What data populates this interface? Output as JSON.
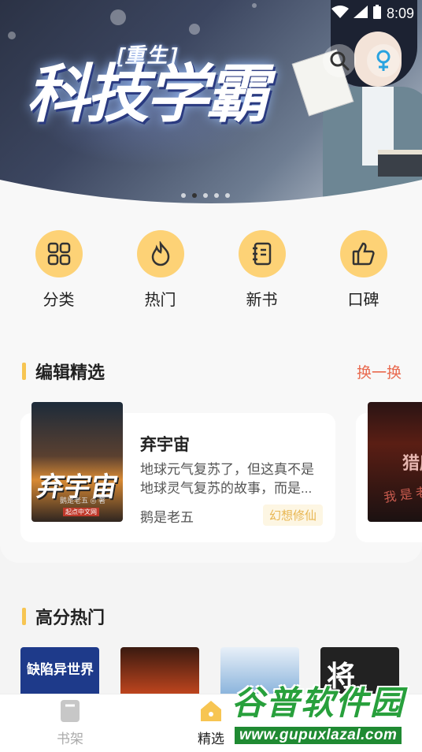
{
  "status_bar": {
    "time": "8:09"
  },
  "banner": {
    "subtitle": "[重生]",
    "title": "科技学霸",
    "page_count": 5,
    "active_page": 2
  },
  "quick_links": [
    {
      "label": "分类",
      "icon": "grid-icon"
    },
    {
      "label": "热门",
      "icon": "fire-icon"
    },
    {
      "label": "新书",
      "icon": "notebook-icon"
    },
    {
      "label": "口碑",
      "icon": "thumbs-up-icon"
    }
  ],
  "editor_picks": {
    "title": "编辑精选",
    "action": "换一换",
    "book": {
      "cover_title": "弃宇宙",
      "cover_author": "鹅是老五 ◎ 著",
      "cover_publisher": "起点中文网",
      "title": "弃宇宙",
      "description": "地球元气复苏了，但这真不是地球灵气复苏的故事，而是...",
      "author": "鹅是老五",
      "tag": "幻想修仙"
    },
    "next_book": {
      "cover_title": "猎魔",
      "cover_sub": "我 是 老"
    }
  },
  "hot": {
    "title": "高分热门",
    "covers": [
      {
        "text": "缺陷异世界",
        "color": "#1e3a8a"
      },
      {
        "text": "",
        "color": "#b0391c"
      },
      {
        "text": "",
        "color": "#9cc4e4"
      },
      {
        "text": "将",
        "color": "#222222"
      }
    ]
  },
  "bottom_nav": {
    "items": [
      {
        "label": "书架",
        "icon": "bookshelf-icon",
        "active": false
      },
      {
        "label": "精选",
        "icon": "home-icon",
        "active": true
      }
    ]
  },
  "watermark": {
    "main": "谷普软件园",
    "url": "www.gupuxlazal.com"
  },
  "colors": {
    "accent": "#f7c552",
    "action": "#e96a4f",
    "tag": "#e8b652"
  }
}
